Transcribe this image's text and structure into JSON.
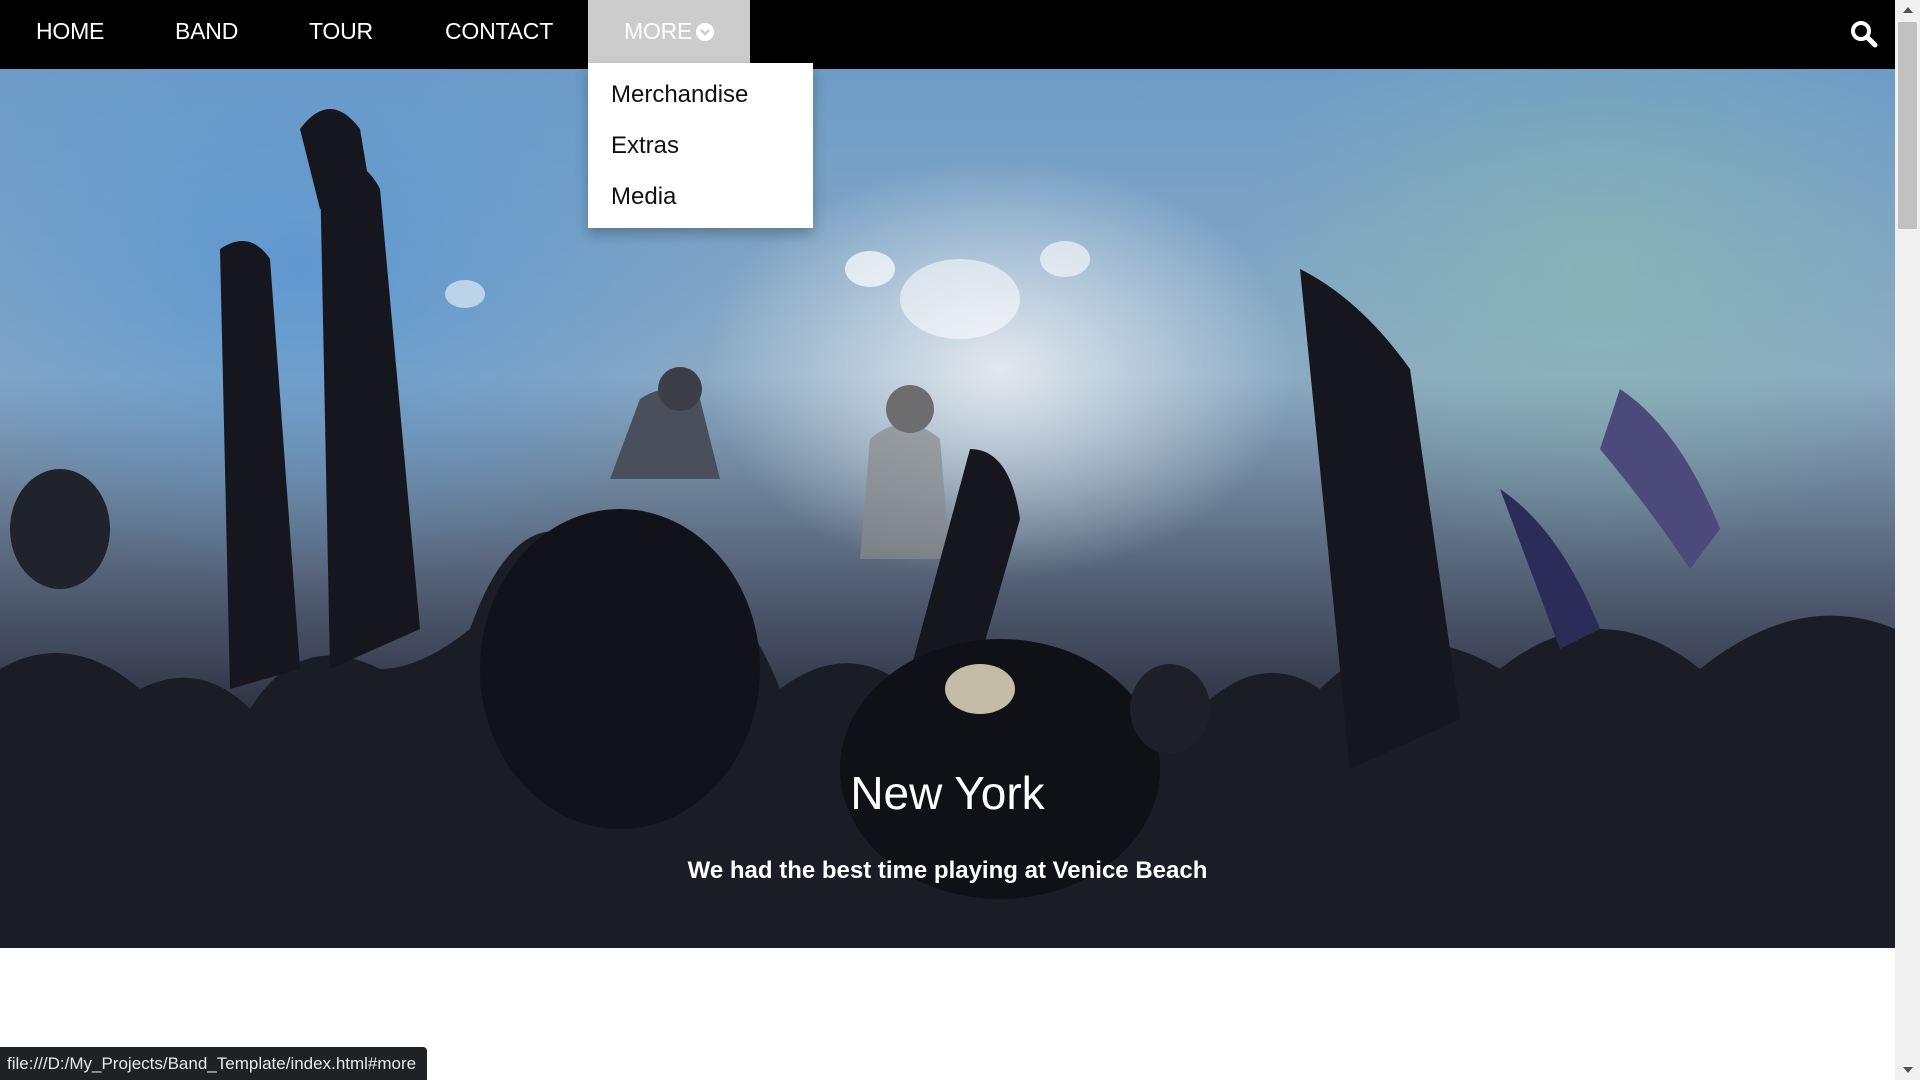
{
  "nav": {
    "items": [
      {
        "label": "HOME"
      },
      {
        "label": "BAND"
      },
      {
        "label": "TOUR"
      },
      {
        "label": "CONTACT"
      },
      {
        "label": "MORE"
      }
    ],
    "more_icon": "chevron-circle-down-icon",
    "search_icon": "search-icon"
  },
  "dropdown": {
    "items": [
      {
        "label": "Merchandise"
      },
      {
        "label": "Extras"
      },
      {
        "label": "Media"
      }
    ]
  },
  "hero": {
    "title": "New York",
    "subtitle": "We had the best time playing at Venice Beach"
  },
  "status_url": "file:///D:/My_Projects/Band_Template/index.html#more",
  "colors": {
    "nav_bg": "#000000",
    "active_item_bg": "#cccccc",
    "text": "#ffffff"
  }
}
